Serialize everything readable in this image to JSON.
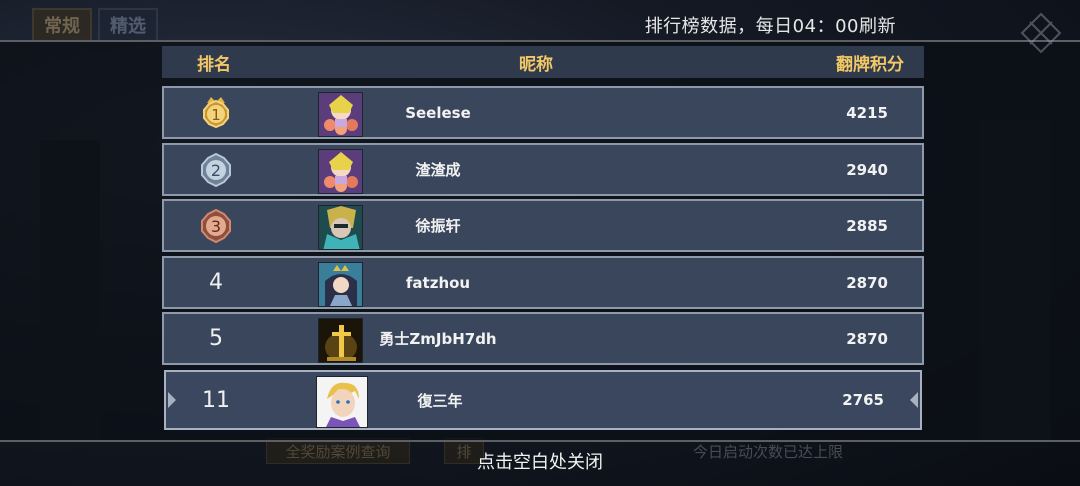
{
  "notice": "排行榜数据，每日04：00刷新",
  "background": {
    "tabs": [
      "常规",
      "精选"
    ],
    "bottom_buttons": [
      "全奖励案例查询",
      "排"
    ],
    "bottom_status": "今日启动次数已达上限"
  },
  "board": {
    "headers": {
      "rank": "排名",
      "nickname": "昵称",
      "score": "翻牌积分"
    },
    "rows": [
      {
        "rank": "1",
        "nickname": "Seelese",
        "score": "4215",
        "badge": "gold",
        "avatar": "flower-mage-avatar"
      },
      {
        "rank": "2",
        "nickname": "渣渣成",
        "score": "2940",
        "badge": "silver",
        "avatar": "flower-mage-avatar"
      },
      {
        "rank": "3",
        "nickname": "徐振轩",
        "score": "2885",
        "badge": "bronze",
        "avatar": "masked-warrior-avatar"
      },
      {
        "rank": "4",
        "nickname": "fatzhou",
        "score": "2870",
        "badge": "none",
        "avatar": "crowned-hero-avatar"
      },
      {
        "rank": "5",
        "nickname": "勇士ZmJbH7dh",
        "score": "2870",
        "badge": "none",
        "avatar": "golden-sword-avatar"
      }
    ],
    "me": {
      "rank": "11",
      "nickname": "復三年",
      "score": "2765",
      "avatar": "blonde-hero-avatar"
    }
  },
  "close_hint": "点击空白处关闭",
  "colors": {
    "header_text": "#f2c866",
    "row_bg": "#3a465c",
    "gold": "#e3b64a",
    "silver": "#9fb0c4",
    "bronze": "#b8705a"
  }
}
